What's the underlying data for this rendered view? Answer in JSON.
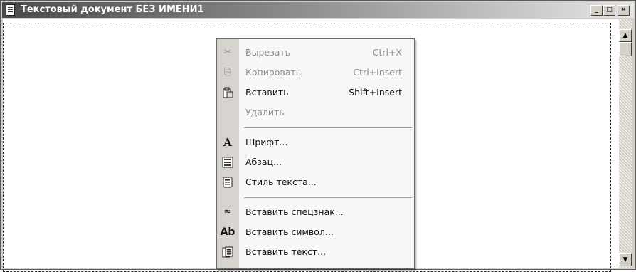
{
  "window": {
    "title": "Текстовый документ БЕЗ ИМЕНИ1",
    "controls": {
      "minimize": "_",
      "maximize": "□",
      "close": "✕"
    }
  },
  "scrollbar": {
    "up_arrow": "▲",
    "down_arrow": "▼"
  },
  "context_menu": {
    "items": [
      {
        "label": "Вырезать",
        "shortcut": "Ctrl+X",
        "icon": "cut-icon",
        "enabled": false
      },
      {
        "label": "Копировать",
        "shortcut": "Ctrl+Insert",
        "icon": "copy-icon",
        "enabled": false
      },
      {
        "label": "Вставить",
        "shortcut": "Shift+Insert",
        "icon": "paste-icon",
        "enabled": true
      },
      {
        "label": "Удалить",
        "shortcut": "",
        "icon": "",
        "enabled": false
      },
      {
        "label": "Шрифт...",
        "shortcut": "",
        "icon": "font-icon",
        "enabled": true
      },
      {
        "label": "Абзац...",
        "shortcut": "",
        "icon": "paragraph-icon",
        "enabled": true
      },
      {
        "label": "Стиль текста...",
        "shortcut": "",
        "icon": "text-style-icon",
        "enabled": true
      },
      {
        "label": "Вставить спецзнак...",
        "shortcut": "",
        "icon": "special-char-icon",
        "enabled": true
      },
      {
        "label": "Вставить символ...",
        "shortcut": "",
        "icon": "insert-symbol-icon",
        "enabled": true
      },
      {
        "label": "Вставить текст...",
        "shortcut": "",
        "icon": "insert-text-icon",
        "enabled": true
      }
    ],
    "icon_glyphs": {
      "cut": "✂",
      "copy": "⎘",
      "paste": "📋",
      "font": "A",
      "paragraph": "¶",
      "text_style": "▤",
      "special_char": "≈",
      "insert_symbol": "Ab",
      "insert_text": "▦"
    }
  }
}
